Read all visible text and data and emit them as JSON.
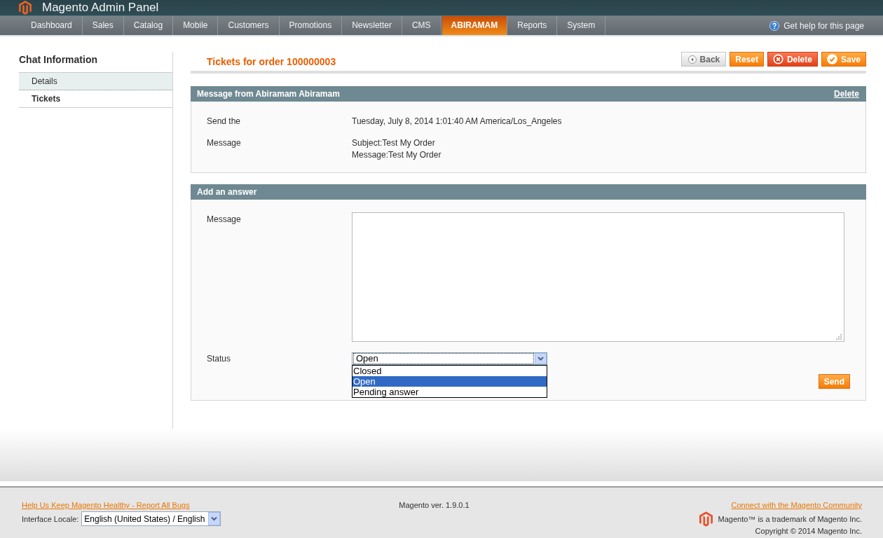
{
  "header": {
    "logo_text": "Magento Admin Panel"
  },
  "nav": {
    "items": [
      {
        "label": "Dashboard",
        "selected": false
      },
      {
        "label": "Sales",
        "selected": false
      },
      {
        "label": "Catalog",
        "selected": false
      },
      {
        "label": "Mobile",
        "selected": false
      },
      {
        "label": "Customers",
        "selected": false
      },
      {
        "label": "Promotions",
        "selected": false
      },
      {
        "label": "Newsletter",
        "selected": false
      },
      {
        "label": "CMS",
        "selected": false
      },
      {
        "label": "ABIRAMAM",
        "selected": true
      },
      {
        "label": "Reports",
        "selected": false
      },
      {
        "label": "System",
        "selected": false
      }
    ],
    "help_link": "Get help for this page"
  },
  "sidebar": {
    "title": "Chat Information",
    "items": [
      {
        "label": "Details",
        "selected": false
      },
      {
        "label": "Tickets",
        "selected": true
      }
    ]
  },
  "content_header": {
    "title": "Tickets for order 100000003",
    "buttons": [
      {
        "label": "Back",
        "kind": "back"
      },
      {
        "label": "Reset",
        "kind": "reset"
      },
      {
        "label": "Delete",
        "kind": "delete"
      },
      {
        "label": "Save",
        "kind": "save"
      }
    ]
  },
  "message_section": {
    "title": "Message from Abiramam Abiramam",
    "action": "Delete",
    "fields": [
      {
        "label": "Send the",
        "lines": [
          "Tuesday, July 8, 2014 1:01:40 AM America/Los_Angeles"
        ]
      },
      {
        "label": "Message",
        "lines": [
          "Subject:Test My Order",
          "Message:Test My Order"
        ]
      }
    ]
  },
  "answer_section": {
    "title": "Add an answer",
    "message_label": "Message",
    "status": {
      "label": "Status",
      "value": "Open",
      "expanded": true,
      "options": [
        {
          "label": "Closed",
          "selected": false
        },
        {
          "label": "Open",
          "selected": true
        },
        {
          "label": "Pending answer",
          "selected": false
        }
      ]
    },
    "send_button": "Send"
  },
  "footer": {
    "bug_link": "Help Us Keep Magento Healthy - Report All Bugs",
    "locale": {
      "label": "Interface Locale:",
      "value": "English (United States) / English"
    },
    "version": "Magento ver. 1.9.0.1",
    "community_link": "Connect with the Magento Community",
    "trademark": "Magento™ is a trademark of Magento Inc.",
    "copyright": "Copyright © 2014 Magento Inc."
  }
}
